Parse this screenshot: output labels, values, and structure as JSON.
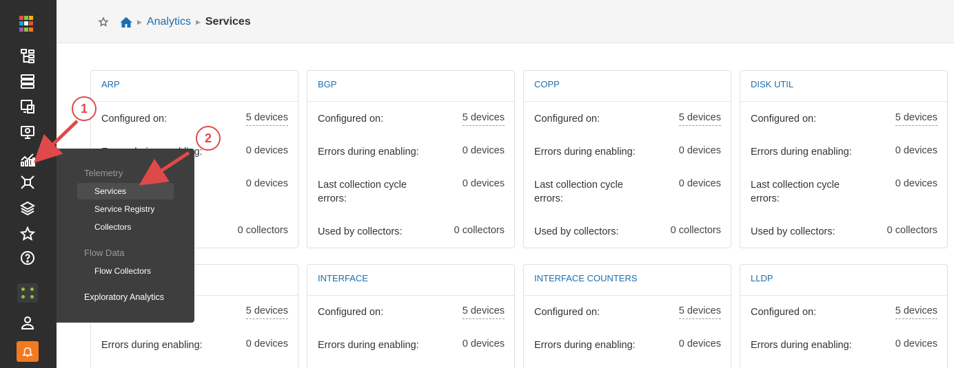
{
  "header": {
    "breadcrumb": {
      "parent": "Analytics",
      "current": "Services"
    }
  },
  "sidebar": {
    "icons": [
      "logo-icon",
      "blueprints-icon",
      "devices-icon",
      "design-icon",
      "resources-icon",
      "analytics-icon",
      "external-systems-icon",
      "platform-icon",
      "favorites-icon",
      "help-icon",
      "apps-icon",
      "user-icon",
      "notifications-icon"
    ]
  },
  "flyout": {
    "telemetry_heading": "Telemetry",
    "services": "Services",
    "service_registry": "Service Registry",
    "collectors": "Collectors",
    "flow_heading": "Flow Data",
    "flow_collectors": "Flow Collectors",
    "exploratory": "Exploratory Analytics"
  },
  "labels": {
    "configured": "Configured on:",
    "errors": "Errors during enabling:",
    "last_cycle": "Last collection cycle errors:",
    "used_by": "Used by collectors:"
  },
  "cards": [
    {
      "title": "ARP",
      "configured": "5 devices",
      "errors": "0 devices",
      "last_cycle": "0 devices",
      "used_by": "0 collectors",
      "partial_label": "Errors during enabling:"
    },
    {
      "title": "BGP",
      "configured": "5 devices",
      "errors": "0 devices",
      "last_cycle": "0 devices",
      "used_by": "0 collectors"
    },
    {
      "title": "COPP",
      "configured": "5 devices",
      "errors": "0 devices",
      "last_cycle": "0 devices",
      "used_by": "0 collectors"
    },
    {
      "title": "DISK UTIL",
      "configured": "5 devices",
      "errors": "0 devices",
      "last_cycle": "0 devices",
      "used_by": "0 collectors"
    },
    {
      "title": "",
      "configured": "5 devices",
      "errors": "0 devices"
    },
    {
      "title": "INTERFACE",
      "configured": "5 devices",
      "errors": "0 devices"
    },
    {
      "title": "INTERFACE COUNTERS",
      "configured": "5 devices",
      "errors": "0 devices"
    },
    {
      "title": "LLDP",
      "configured": "5 devices",
      "errors": "0 devices"
    }
  ],
  "callouts": {
    "first": "1",
    "second": "2"
  },
  "colors": {
    "sidebar": "#2e2e2e",
    "link": "#1a6fb0",
    "callout": "#e04949",
    "notify": "#f47a1f",
    "apps_dots": "#8fc04a"
  }
}
